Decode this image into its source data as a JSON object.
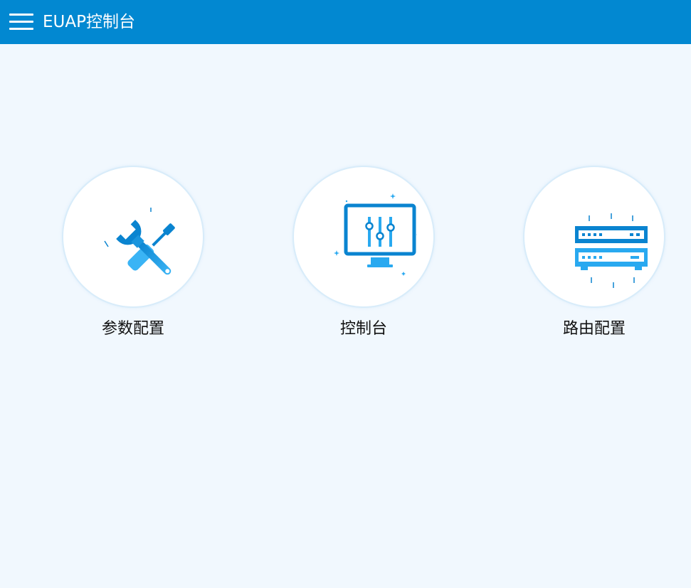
{
  "header": {
    "title": "EUAP控制台"
  },
  "tiles": [
    {
      "label": "参数配置",
      "icon": "tools-icon"
    },
    {
      "label": "控制台",
      "icon": "monitor-sliders-icon"
    },
    {
      "label": "路由配置",
      "icon": "router-icon"
    }
  ],
  "colors": {
    "header_bg": "#0288d1",
    "page_bg": "#f1f8fe",
    "icon_dark": "#0288d1",
    "icon_light": "#29a9f0"
  }
}
